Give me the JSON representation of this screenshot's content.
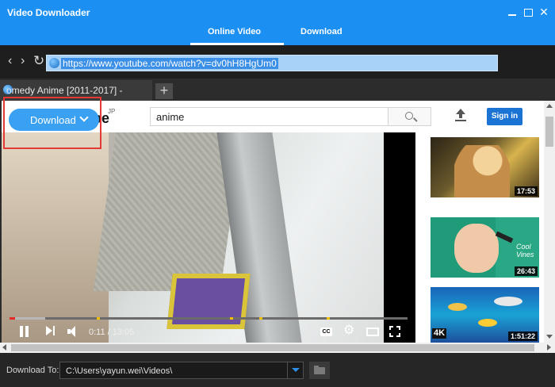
{
  "app": {
    "title": "Video Downloader"
  },
  "top_tabs": [
    {
      "label": "Online Video",
      "active": true
    },
    {
      "label": "Download",
      "active": false
    }
  ],
  "nav": {
    "url": "https://www.youtube.com/watch?v=dv0hH8HgUm0"
  },
  "browser_tab": {
    "label": "omedy Anime [2011-2017] -"
  },
  "youtube": {
    "logo_text": "be",
    "logo_sup": "JP",
    "search_value": "anime",
    "signin_label": "Sign in"
  },
  "download_button": {
    "label": "Download"
  },
  "player": {
    "time": "0:11 / 13:05",
    "progress_fraction": 0.014,
    "buffer_fraction": 0.09,
    "cc_label": "CC"
  },
  "thumbnails": [
    {
      "duration": "17:53"
    },
    {
      "duration": "26:43",
      "overlay_text": "Cool Vines"
    },
    {
      "duration": "1:51:22",
      "badge": "4K"
    }
  ],
  "footer": {
    "label": "Download To:",
    "path": "C:\\Users\\yayun.wei\\Videos\\"
  },
  "colors": {
    "accent": "#1b8ff2",
    "progress": "#e52d27",
    "highlight_box": "#e53935"
  }
}
